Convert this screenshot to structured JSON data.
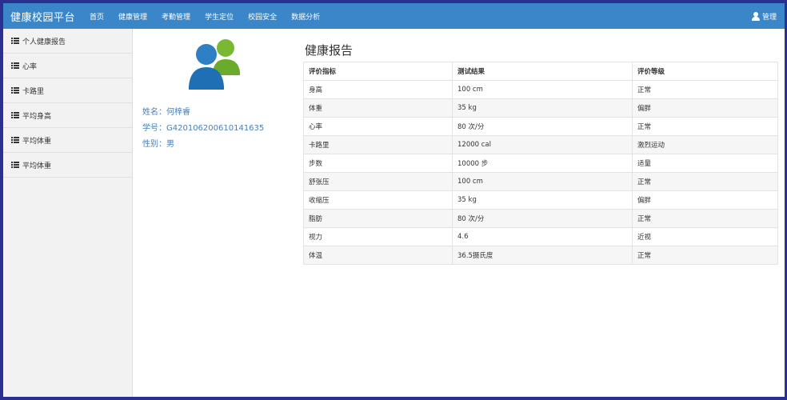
{
  "app": {
    "brand": "健康校园平台"
  },
  "nav": {
    "items": [
      {
        "label": "首页"
      },
      {
        "label": "健康管理"
      },
      {
        "label": "考勤管理"
      },
      {
        "label": "学生定位"
      },
      {
        "label": "校园安全"
      },
      {
        "label": "数据分析"
      }
    ],
    "user_label": "管理"
  },
  "sidebar": {
    "items": [
      {
        "label": "个人健康报告"
      },
      {
        "label": "心率"
      },
      {
        "label": "卡路里"
      },
      {
        "label": "平均身高"
      },
      {
        "label": "平均体重"
      },
      {
        "label": "平均体重"
      }
    ]
  },
  "profile": {
    "name": "姓名：何梓睿",
    "student_id": "学号：G420106200610141635",
    "gender": "性别：男"
  },
  "report": {
    "title": "健康报告",
    "columns": [
      "评价指标",
      "测试结果",
      "评价等级"
    ],
    "rows": [
      [
        "身高",
        "100 cm",
        "正常"
      ],
      [
        "体重",
        "35 kg",
        "偏胖"
      ],
      [
        "心率",
        "80 次/分",
        "正常"
      ],
      [
        "卡路里",
        "12000 cal",
        "激烈运动"
      ],
      [
        "步数",
        "10000 步",
        "适量"
      ],
      [
        "舒张压",
        "100 cm",
        "正常"
      ],
      [
        "收缩压",
        "35 kg",
        "偏胖"
      ],
      [
        "脂肪",
        "80 次/分",
        "正常"
      ],
      [
        "视力",
        "4.6",
        "近视"
      ],
      [
        "体温",
        "36.5摄氏度",
        "正常"
      ]
    ]
  },
  "colors": {
    "navbar": "#3a86c8",
    "frame": "#2b2f8f",
    "profile_text": "#4a7fb5"
  }
}
